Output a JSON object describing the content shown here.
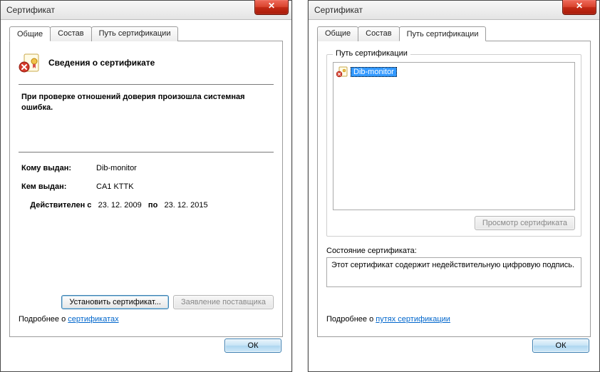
{
  "left": {
    "title": "Сертификат",
    "close_glyph": "✕",
    "tabs": {
      "general": "Общие",
      "details": "Состав",
      "path": "Путь сертификации"
    },
    "active_tab": 0,
    "cert_title": "Сведения о сертификате",
    "cert_message": "При проверке отношений доверия произошла системная ошибка.",
    "issued_to_label": "Кому выдан:",
    "issued_to_value": "Dib-monitor",
    "issued_by_label": "Кем выдан:",
    "issued_by_value": "CA1 KTTK",
    "valid_from_label": "Действителен с",
    "valid_from_value": "23. 12. 2009",
    "valid_to_label": "по",
    "valid_to_value": "23. 12. 2015",
    "install_btn": "Установить сертификат...",
    "issuer_stmt_btn": "Заявление поставщика",
    "more_prefix": "Подробнее о ",
    "more_link": "сертификатах",
    "ok_btn": "ОК"
  },
  "right": {
    "title": "Сертификат",
    "close_glyph": "✕",
    "tabs": {
      "general": "Общие",
      "details": "Состав",
      "path": "Путь сертификации"
    },
    "active_tab": 2,
    "group_title": "Путь сертификации",
    "tree_item": "Dib-monitor",
    "view_cert_btn": "Просмотр сертификата",
    "status_label": "Состояние сертификата:",
    "status_text": "Этот сертификат содержит недействительную цифровую подпись.",
    "more_prefix": "Подробнее о ",
    "more_link": "путях сертификации",
    "ok_btn": "ОК"
  }
}
